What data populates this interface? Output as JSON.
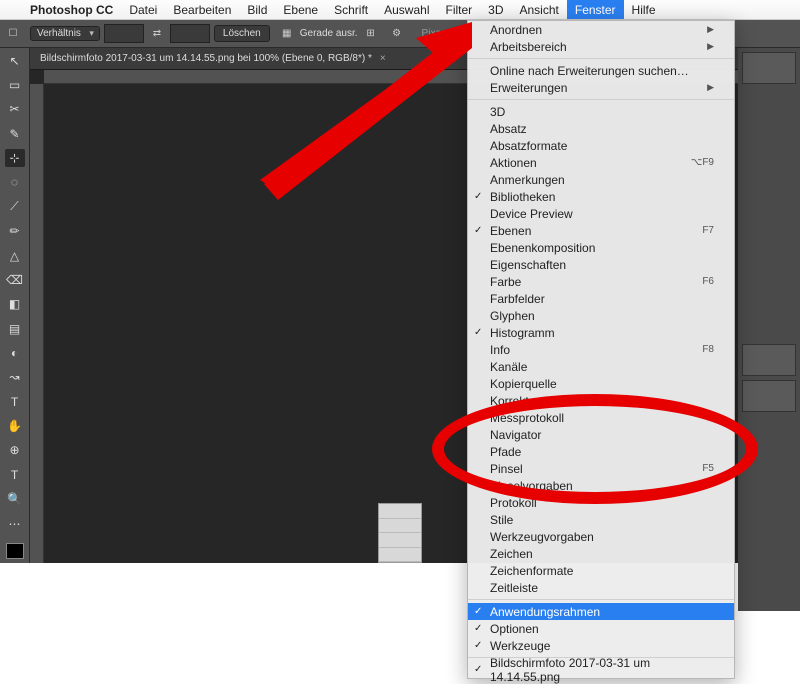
{
  "menubar": {
    "app": "Photoshop CC",
    "items": [
      "Datei",
      "Bearbeiten",
      "Bild",
      "Ebene",
      "Schrift",
      "Auswahl",
      "Filter",
      "3D",
      "Ansicht",
      "Fenster",
      "Hilfe"
    ],
    "active_index": 9
  },
  "optionsbar": {
    "ratio_label": "Verhältnis",
    "swap": "⇄",
    "clear": "Löschen",
    "straighten": "Gerade ausr.",
    "pixel_hint": "Pixe"
  },
  "document": {
    "tab_title": "Bildschirmfoto 2017-03-31 um 14.14.55.png bei 100% (Ebene 0, RGB/8*) *"
  },
  "toolbox": {
    "tools": [
      "↖",
      "▭",
      "✂",
      "✎",
      "⊹",
      "◌",
      "⟋",
      "✏",
      "△",
      "⌫",
      "◧",
      "▤",
      "◐",
      "↝",
      "◯",
      "✋",
      "⊕",
      "T",
      "↖",
      "▭",
      "✋",
      "🔍",
      "⋯"
    ]
  },
  "dropdown": {
    "groups": [
      {
        "items": [
          {
            "label": "Anordnen",
            "submenu": true
          },
          {
            "label": "Arbeitsbereich",
            "submenu": true
          }
        ]
      },
      {
        "items": [
          {
            "label": "Online nach Erweiterungen suchen…"
          },
          {
            "label": "Erweiterungen",
            "submenu": true
          }
        ]
      },
      {
        "items": [
          {
            "label": "3D"
          },
          {
            "label": "Absatz"
          },
          {
            "label": "Absatzformate"
          },
          {
            "label": "Aktionen",
            "shortcut": "⌥F9"
          },
          {
            "label": "Anmerkungen"
          },
          {
            "label": "Bibliotheken",
            "checked": true
          },
          {
            "label": "Device Preview"
          },
          {
            "label": "Ebenen",
            "checked": true,
            "shortcut": "F7"
          },
          {
            "label": "Ebenenkomposition"
          },
          {
            "label": "Eigenschaften"
          },
          {
            "label": "Farbe",
            "shortcut": "F6"
          },
          {
            "label": "Farbfelder"
          },
          {
            "label": "Glyphen"
          },
          {
            "label": "Histogramm",
            "checked": true
          },
          {
            "label": "Info",
            "shortcut": "F8"
          },
          {
            "label": "Kanäle"
          },
          {
            "label": "Kopierquelle"
          },
          {
            "label": "Korrekturen"
          },
          {
            "label": "Messprotokoll"
          },
          {
            "label": "Navigator"
          },
          {
            "label": "Pfade"
          },
          {
            "label": "Pinsel",
            "shortcut": "F5"
          },
          {
            "label": "Pinselvorgaben"
          },
          {
            "label": "Protokoll"
          },
          {
            "label": "Stile"
          },
          {
            "label": "Werkzeugvorgaben"
          },
          {
            "label": "Zeichen"
          },
          {
            "label": "Zeichenformate"
          },
          {
            "label": "Zeitleiste"
          }
        ]
      },
      {
        "items": [
          {
            "label": "Anwendungsrahmen",
            "checked": true,
            "highlight": true
          },
          {
            "label": "Optionen",
            "checked": true
          },
          {
            "label": "Werkzeuge",
            "checked": true
          }
        ]
      },
      {
        "items": [
          {
            "label": "Bildschirmfoto 2017-03-31 um 14.14.55.png",
            "checked": true
          }
        ]
      }
    ]
  }
}
